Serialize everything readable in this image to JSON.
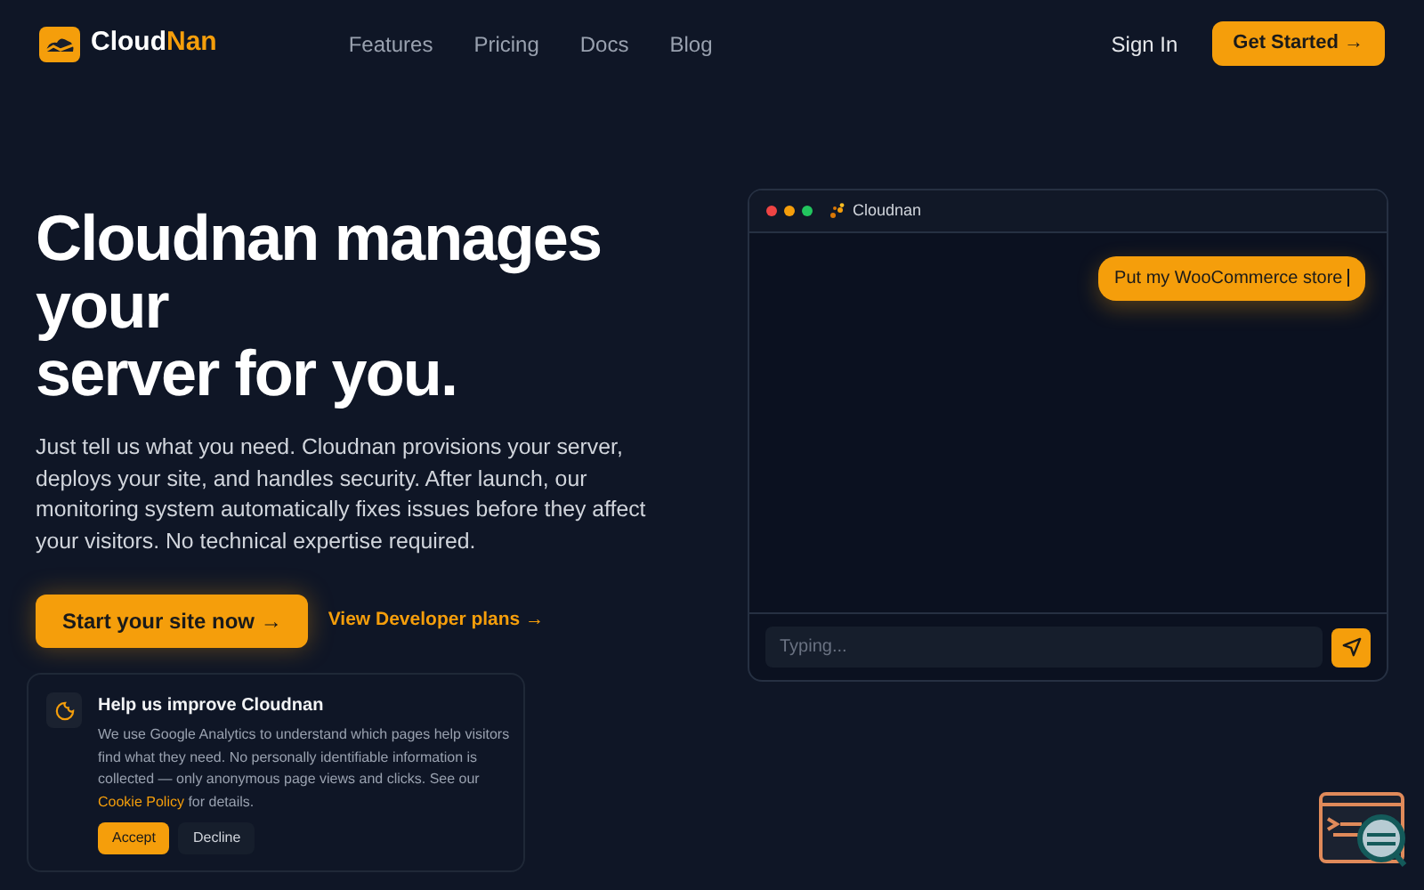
{
  "nav": {
    "brand_start": "Cloud",
    "brand_end": "Nan",
    "links": [
      "Features",
      "Pricing",
      "Docs",
      "Blog"
    ],
    "sign_in": "Sign In",
    "cta": "Get Started →"
  },
  "hero": {
    "title_lines": [
      "Cloudnan manages",
      "your",
      "server for you."
    ],
    "description": "Just tell us what you need. Cloudnan provisions your server, deploys your site, and handles security. After launch, our monitoring system automatically fixes issues before they affect your visitors. No technical expertise required.",
    "primary_button": "Start your site now →",
    "secondary_link": "View Developer plans →"
  },
  "chat": {
    "title": "Cloudnan",
    "message": "Put my WooCommerce store",
    "input_placeholder": "Typing..."
  },
  "cookie": {
    "title": "Help us improve Cloudnan",
    "text": "We use Google Analytics to understand which pages help visitors find what they need. No personally identifiable information is collected — only anonymous page views and clicks. See our ",
    "link": "Cookie Policy",
    "text_end": " for details.",
    "accept": "Accept",
    "decline": "Decline"
  }
}
